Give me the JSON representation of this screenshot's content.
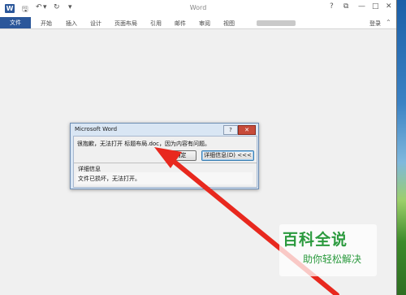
{
  "window": {
    "title": "Word",
    "help": "?",
    "restore": "⧉",
    "minimize": "—",
    "maximize": "□",
    "close": "✕"
  },
  "quick_access": {
    "save_icon": "save-icon",
    "undo_icon": "undo-icon",
    "redo_icon": "redo-icon",
    "customize_icon": "customize-icon"
  },
  "ribbon": {
    "file_tab": "文件",
    "tabs": [
      "开始",
      "插入",
      "设计",
      "页面布局",
      "引用",
      "邮件",
      "审阅",
      "视图"
    ],
    "login": "登录"
  },
  "dialog": {
    "title": "Microsoft Word",
    "help_button": "?",
    "close_button": "✕",
    "message": "很抱歉，无法打开 标题布局.doc，因为内容有问题。",
    "ok_button": "确定",
    "details_button": "详细信息(D) <<<",
    "details_heading": "详细信息",
    "details_text": "文件已损坏，无法打开。"
  },
  "watermark": {
    "main": "百科全说",
    "sub": "助你轻松解决"
  },
  "colors": {
    "accent": "#2b579a",
    "arrow": "#e8281e",
    "watermark": "#2b9a3e"
  }
}
